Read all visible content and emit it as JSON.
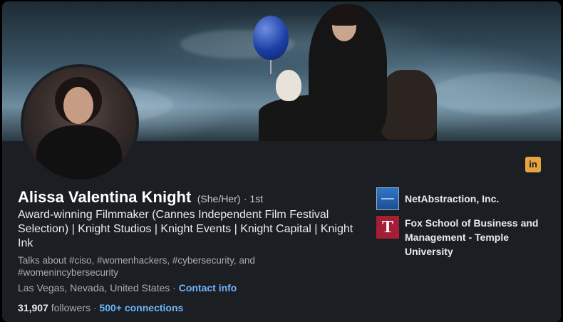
{
  "profile": {
    "name": "Alissa Valentina Knight",
    "pronouns": "(She/Her)",
    "degree": "· 1st",
    "headline": "Award-winning Filmmaker (Cannes Independent Film Festival Selection) | Knight Studios | Knight Events | Knight Capital | Knight Ink",
    "talks_about": "Talks about #ciso, #womenhackers, #cybersecurity, and #womenincybersecurity",
    "location": "Las Vegas, Nevada, United States",
    "location_sep": " · ",
    "contact_info_label": "Contact info",
    "followers_count": "31,907",
    "followers_label": "followers",
    "connections_sep": " · ",
    "connections_label": "500+ connections"
  },
  "badge": {
    "icon": "linkedin-icon",
    "text": "in",
    "color": "#e7a33e"
  },
  "organizations": [
    {
      "name": "NetAbstraction, Inc.",
      "logo": "netabstraction-logo"
    },
    {
      "name": "Fox School of Business and Management - Temple University",
      "logo": "temple-logo",
      "logo_glyph": "T"
    }
  ],
  "colors": {
    "background": "#1b1f23",
    "link": "#70b5f9",
    "text": "#e9ebed",
    "muted": "#a8adb2"
  }
}
